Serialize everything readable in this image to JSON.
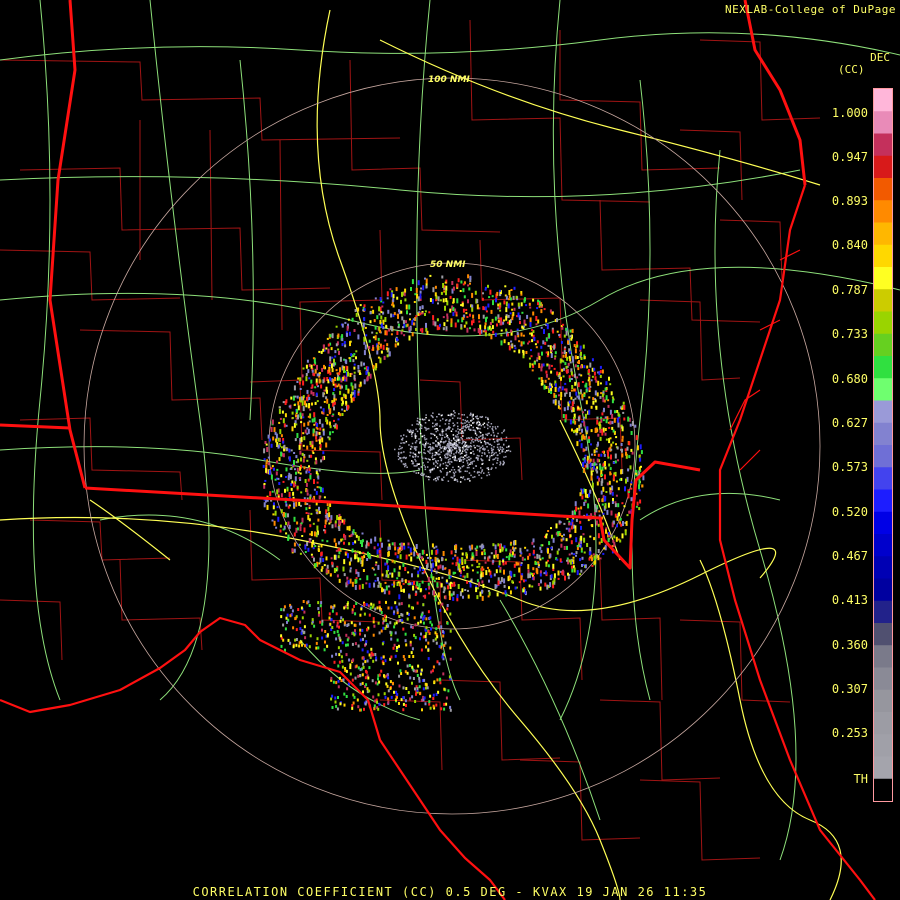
{
  "credit": "NEXLAB-College of DuPage",
  "units": {
    "line1": "DEC",
    "line2": "(CC)"
  },
  "range_rings": [
    {
      "label": "100 NMI",
      "range_nmi": 100
    },
    {
      "label": "50 NMI",
      "range_nmi": 50
    }
  ],
  "legend": {
    "labels": [
      "1.000",
      "0.947",
      "0.893",
      "0.840",
      "0.787",
      "0.733",
      "0.680",
      "0.627",
      "0.573",
      "0.520",
      "0.467",
      "0.413",
      "0.360",
      "0.307",
      "0.253",
      "TH"
    ],
    "colors": [
      "#ffb6d9",
      "#e98bb8",
      "#c4305c",
      "#d81a1a",
      "#f25a00",
      "#ff8a00",
      "#ffb700",
      "#ffd800",
      "#ffff22",
      "#cccc00",
      "#9ad400",
      "#66d020",
      "#30e040",
      "#6fff6f",
      "#9a9ad8",
      "#8282d0",
      "#6f6fd6",
      "#4343ee",
      "#1d1dff",
      "#0000e6",
      "#0000cc",
      "#0000b4",
      "#0000a0",
      "#22228a",
      "#505070",
      "#7a7a8a",
      "#8a8a96",
      "#96969e",
      "#9c9ca4",
      "#a0a0a8",
      "#a4a4ac",
      "#000000"
    ],
    "border_color": "#ff9aa0"
  },
  "footer": "CORRELATION COEFFICIENT (CC) 0.5 DEG - KVAX 19 JAN 26 11:35",
  "colors": {
    "state_border": "#ff1010",
    "county": "#a01414",
    "highway": "#ffff55",
    "road": "#8ee07a",
    "ring": "#c8a8a0"
  }
}
